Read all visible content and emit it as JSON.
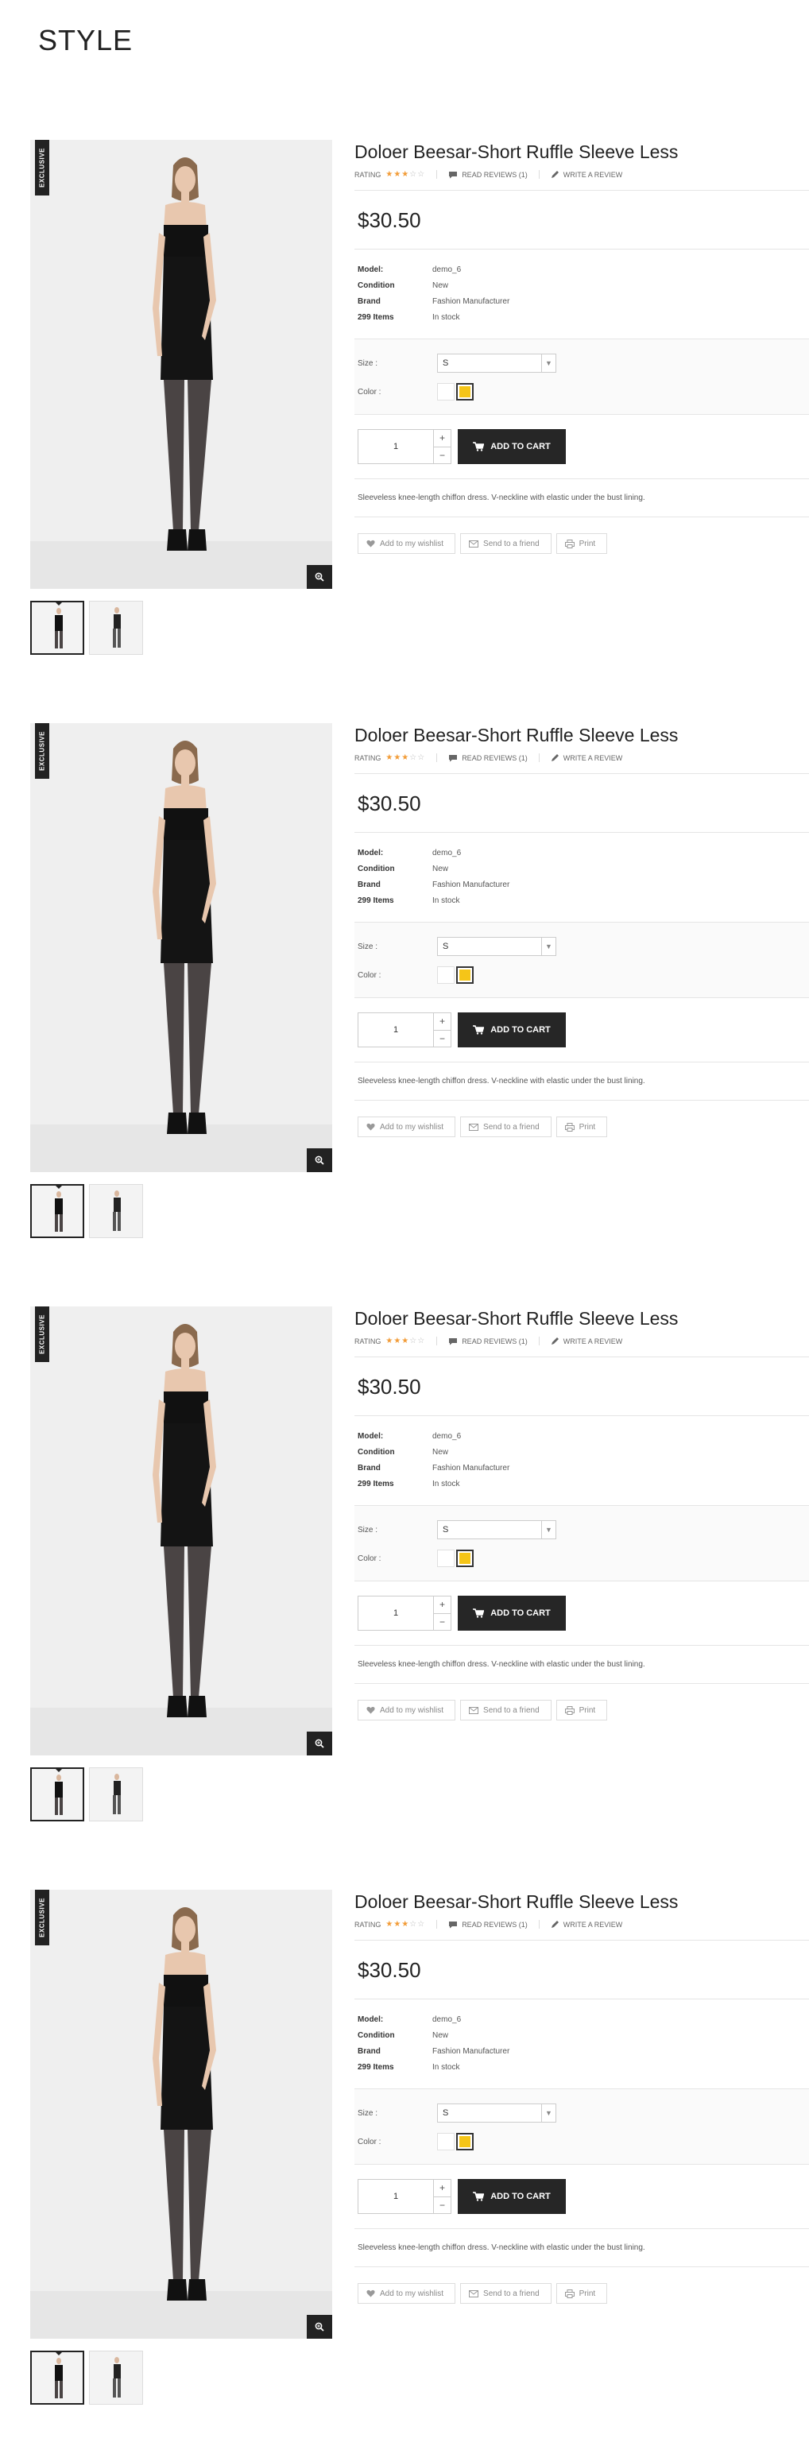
{
  "page": {
    "title": "STYLE"
  },
  "colors": {
    "accent_star": "#f29c38",
    "dark": "#262626",
    "swatch_yellow": "#f5c518"
  },
  "icons": {
    "zoom": "zoom-in-icon",
    "review": "speech-bubble-icon",
    "write": "pencil-icon",
    "cart": "cart-icon",
    "wishlist": "heart-icon",
    "send": "envelope-icon",
    "print": "printer-icon"
  },
  "products": [
    {
      "badge": "EXCLUSIVE",
      "name": "Doloer Beesar-Short Ruffle Sleeve Less",
      "rating_label": "RATING",
      "rating": 3,
      "rating_max": 5,
      "read_reviews": "READ REVIEWS (1)",
      "write_review": "WRITE A REVIEW",
      "price": "$30.50",
      "specs": [
        {
          "label": "Model:",
          "value": "demo_6"
        },
        {
          "label": "Condition",
          "value": "New"
        },
        {
          "label": "Brand",
          "value": "Fashion Manufacturer"
        },
        {
          "label": "299 Items",
          "value": "In stock"
        }
      ],
      "size_label": "Size :",
      "size_value": "S",
      "color_label": "Color :",
      "quantity": "1",
      "qty_plus": "+",
      "qty_minus": "−",
      "add_to_cart": "ADD TO CART",
      "description": "Sleeveless knee-length chiffon dress. V-neckline with elastic under the bust lining.",
      "wishlist": "Add to my wishlist",
      "send_friend": "Send to a friend",
      "print": "Print"
    },
    {
      "badge": "EXCLUSIVE",
      "name": "Doloer Beesar-Short Ruffle Sleeve Less",
      "rating_label": "RATING",
      "rating": 3,
      "rating_max": 5,
      "read_reviews": "READ REVIEWS (1)",
      "write_review": "WRITE A REVIEW",
      "price": "$30.50",
      "specs": [
        {
          "label": "Model:",
          "value": "demo_6"
        },
        {
          "label": "Condition",
          "value": "New"
        },
        {
          "label": "Brand",
          "value": "Fashion Manufacturer"
        },
        {
          "label": "299 Items",
          "value": "In stock"
        }
      ],
      "size_label": "Size :",
      "size_value": "S",
      "color_label": "Color :",
      "quantity": "1",
      "qty_plus": "+",
      "qty_minus": "−",
      "add_to_cart": "ADD TO CART",
      "description": "Sleeveless knee-length chiffon dress. V-neckline with elastic under the bust lining.",
      "wishlist": "Add to my wishlist",
      "send_friend": "Send to a friend",
      "print": "Print"
    },
    {
      "badge": "EXCLUSIVE",
      "name": "Doloer Beesar-Short Ruffle Sleeve Less",
      "rating_label": "RATING",
      "rating": 3,
      "rating_max": 5,
      "read_reviews": "READ REVIEWS (1)",
      "write_review": "WRITE A REVIEW",
      "price": "$30.50",
      "specs": [
        {
          "label": "Model:",
          "value": "demo_6"
        },
        {
          "label": "Condition",
          "value": "New"
        },
        {
          "label": "Brand",
          "value": "Fashion Manufacturer"
        },
        {
          "label": "299 Items",
          "value": "In stock"
        }
      ],
      "size_label": "Size :",
      "size_value": "S",
      "color_label": "Color :",
      "quantity": "1",
      "qty_plus": "+",
      "qty_minus": "−",
      "add_to_cart": "ADD TO CART",
      "description": "Sleeveless knee-length chiffon dress. V-neckline with elastic under the bust lining.",
      "wishlist": "Add to my wishlist",
      "send_friend": "Send to a friend",
      "print": "Print"
    },
    {
      "badge": "EXCLUSIVE",
      "name": "Doloer Beesar-Short Ruffle Sleeve Less",
      "rating_label": "RATING",
      "rating": 3,
      "rating_max": 5,
      "read_reviews": "READ REVIEWS (1)",
      "write_review": "WRITE A REVIEW",
      "price": "$30.50",
      "specs": [
        {
          "label": "Model:",
          "value": "demo_6"
        },
        {
          "label": "Condition",
          "value": "New"
        },
        {
          "label": "Brand",
          "value": "Fashion Manufacturer"
        },
        {
          "label": "299 Items",
          "value": "In stock"
        }
      ],
      "size_label": "Size :",
      "size_value": "S",
      "color_label": "Color :",
      "quantity": "1",
      "qty_plus": "+",
      "qty_minus": "−",
      "add_to_cart": "ADD TO CART",
      "description": "Sleeveless knee-length chiffon dress. V-neckline with elastic under the bust lining.",
      "wishlist": "Add to my wishlist",
      "send_friend": "Send to a friend",
      "print": "Print"
    }
  ]
}
